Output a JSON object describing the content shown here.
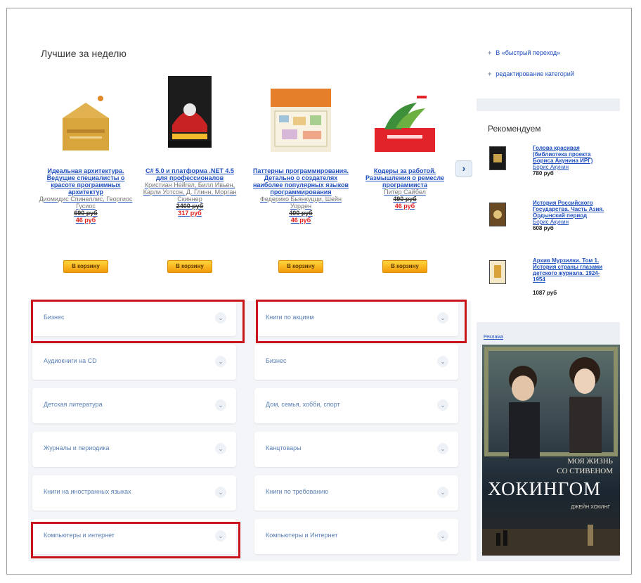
{
  "best": {
    "title": "Лучшие за неделю"
  },
  "books": [
    {
      "title": "Идеальная архитектура. Ведущие специалисты о красоте программных архитектур",
      "authors": "Диомидис Спинеллис, Георгиос Гусиос",
      "old_price": "690 руб",
      "new_price": "46 руб",
      "cart": "В корзину"
    },
    {
      "title": "C# 5.0 и платформа .NET 4.5 для профессионалов",
      "authors": "Кристиан Нейгел, Билл Ивьен, Карли Уотсон, Д. Глинн, Морган Скиннер",
      "old_price": "2400 руб",
      "new_price": "317 руб",
      "cart": "В корзину"
    },
    {
      "title": "Паттерны программирования. Детально о создателях наиболее популярных языков программирования",
      "authors": "Федерико Бьянкуцци, Шейн Уорден",
      "old_price": "400 руб",
      "new_price": "46 руб",
      "cart": "В корзину"
    },
    {
      "title": "Кодеры за работой. Размышления о ремесле программиста",
      "authors": "Питер Сайбел",
      "old_price": "490 руб",
      "new_price": "46 руб",
      "cart": "В корзину"
    }
  ],
  "nav": {
    "next": "›"
  },
  "categories_left": [
    "Бизнес",
    "Аудиокниги на CD",
    "Детская литература",
    "Журналы и периодика",
    "Книги на иностранных языках",
    "Компьютеры и интернет"
  ],
  "categories_right": [
    "Книги по акциям",
    "Бизнес",
    "Дом, семья, хобби, спорт",
    "Канцтовары",
    "Книги по требованию",
    "Компьютеры и Интернет"
  ],
  "side": {
    "quick_link": "В «быстрый переход»",
    "edit_link": "редактирование категорий",
    "recommend_title": "Рекомендуем",
    "rec": [
      {
        "title": "Голова красивая (библиотека проекта Бориса Акунина ИРГ)",
        "author": "Борис Акунин",
        "price": "780 руб"
      },
      {
        "title": "История Российского Государства. Часть Азия. Ордынский период",
        "author": "Борис Акунин",
        "price": "608 руб"
      },
      {
        "title": "Архив Мурзилки. Том 1. История страны глазами детского журнала. 1924-1954",
        "author": "",
        "price": "1087 руб"
      }
    ],
    "ad_label": "Реклама",
    "ad_line1": "МОЯ ЖИЗНЬ",
    "ad_line2": "СО СТИВЕНОМ",
    "ad_line3": "ХОКИНГОМ",
    "ad_line4": "ДЖЕЙН ХОКИНГ"
  },
  "colors": {
    "highlight": "#c8141b",
    "link": "#1f4fbf",
    "price": "#e0201c",
    "button": "#f6b21d"
  },
  "icons": {
    "chevron": "chevron-down-icon",
    "plus": "plus-icon",
    "arrow": "arrow-right-icon"
  }
}
